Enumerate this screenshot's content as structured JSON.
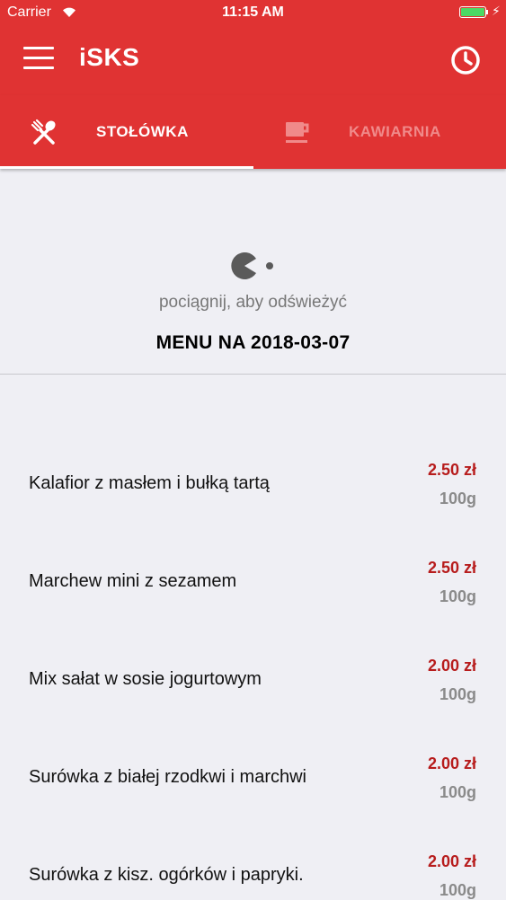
{
  "status_bar": {
    "carrier": "Carrier",
    "time": "11:15 AM",
    "battery_color": "#4cd964"
  },
  "app_bar": {
    "title": "iSKS",
    "menu_icon": "hamburger-menu-icon",
    "history_icon": "clock-icon",
    "background_color": "#e03333"
  },
  "tabs": [
    {
      "label": "STOŁÓWKA",
      "icon": "fork-spoon-icon",
      "selected": true
    },
    {
      "label": "KAWIARNIA",
      "icon": "coffee-cup-icon",
      "selected": false
    }
  ],
  "refresh": {
    "icon": "pacman-loader-icon",
    "hint": "pociągnij, aby odświeżyć"
  },
  "menu": {
    "title": "MENU NA 2018-03-07",
    "price_color": "#b71c1c",
    "items": [
      {
        "name": "Kalafior z masłem i bułką tartą",
        "price": "2.50 zł",
        "weight": "100g"
      },
      {
        "name": "Marchew mini  z sezamem",
        "price": "2.50 zł",
        "weight": "100g"
      },
      {
        "name": "Mix sałat w sosie jogurtowym",
        "price": "2.00 zł",
        "weight": "100g"
      },
      {
        "name": "Surówka z białej rzodkwi i marchwi",
        "price": "2.00 zł",
        "weight": "100g"
      },
      {
        "name": "Surówka z kisz. ogórków i papryki.",
        "price": "2.00 zł",
        "weight": "100g"
      }
    ]
  }
}
